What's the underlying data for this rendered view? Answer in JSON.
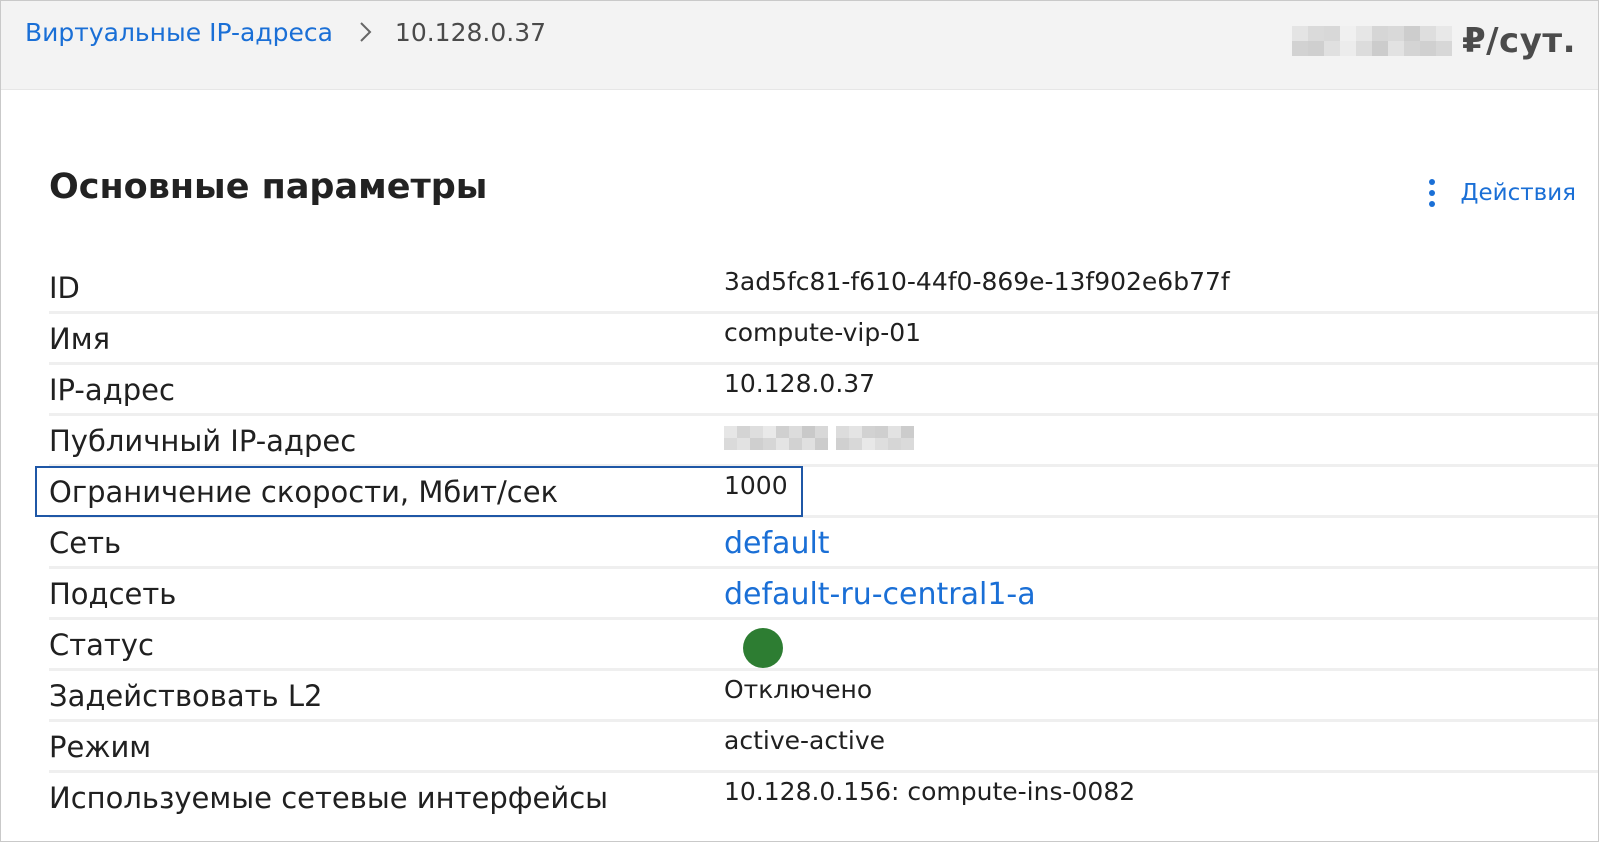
{
  "breadcrumb": {
    "parent": "Виртуальные IP-адреса",
    "current": "10.128.0.37"
  },
  "price": {
    "unit": "₽/сут."
  },
  "section": {
    "title": "Основные параметры",
    "actions_label": "Действия"
  },
  "properties": [
    {
      "label": "ID",
      "value": "3ad5fc81-f610-44f0-869e-13f902e6b77f"
    },
    {
      "label": "Имя",
      "value": "compute-vip-01"
    },
    {
      "label": "IP-адрес",
      "value": "10.128.0.37"
    },
    {
      "label": "Публичный IP-адрес",
      "value": ""
    },
    {
      "label": "Ограничение скорости, Мбит/сек",
      "value": "1000"
    },
    {
      "label": "Сеть",
      "value": "default"
    },
    {
      "label": "Подсеть",
      "value": "default-ru-central1-a"
    },
    {
      "label": "Статус",
      "value": ""
    },
    {
      "label": "Задействовать L2",
      "value": "Отключено"
    },
    {
      "label": "Режим",
      "value": "active-active"
    },
    {
      "label": "Используемые сетевые интерфейсы",
      "value": "10.128.0.156: compute-ins-0082"
    }
  ],
  "colors": {
    "accent": "#1a6fd6",
    "status_ok": "#2d7d32",
    "highlight_border": "#1f57a6"
  }
}
